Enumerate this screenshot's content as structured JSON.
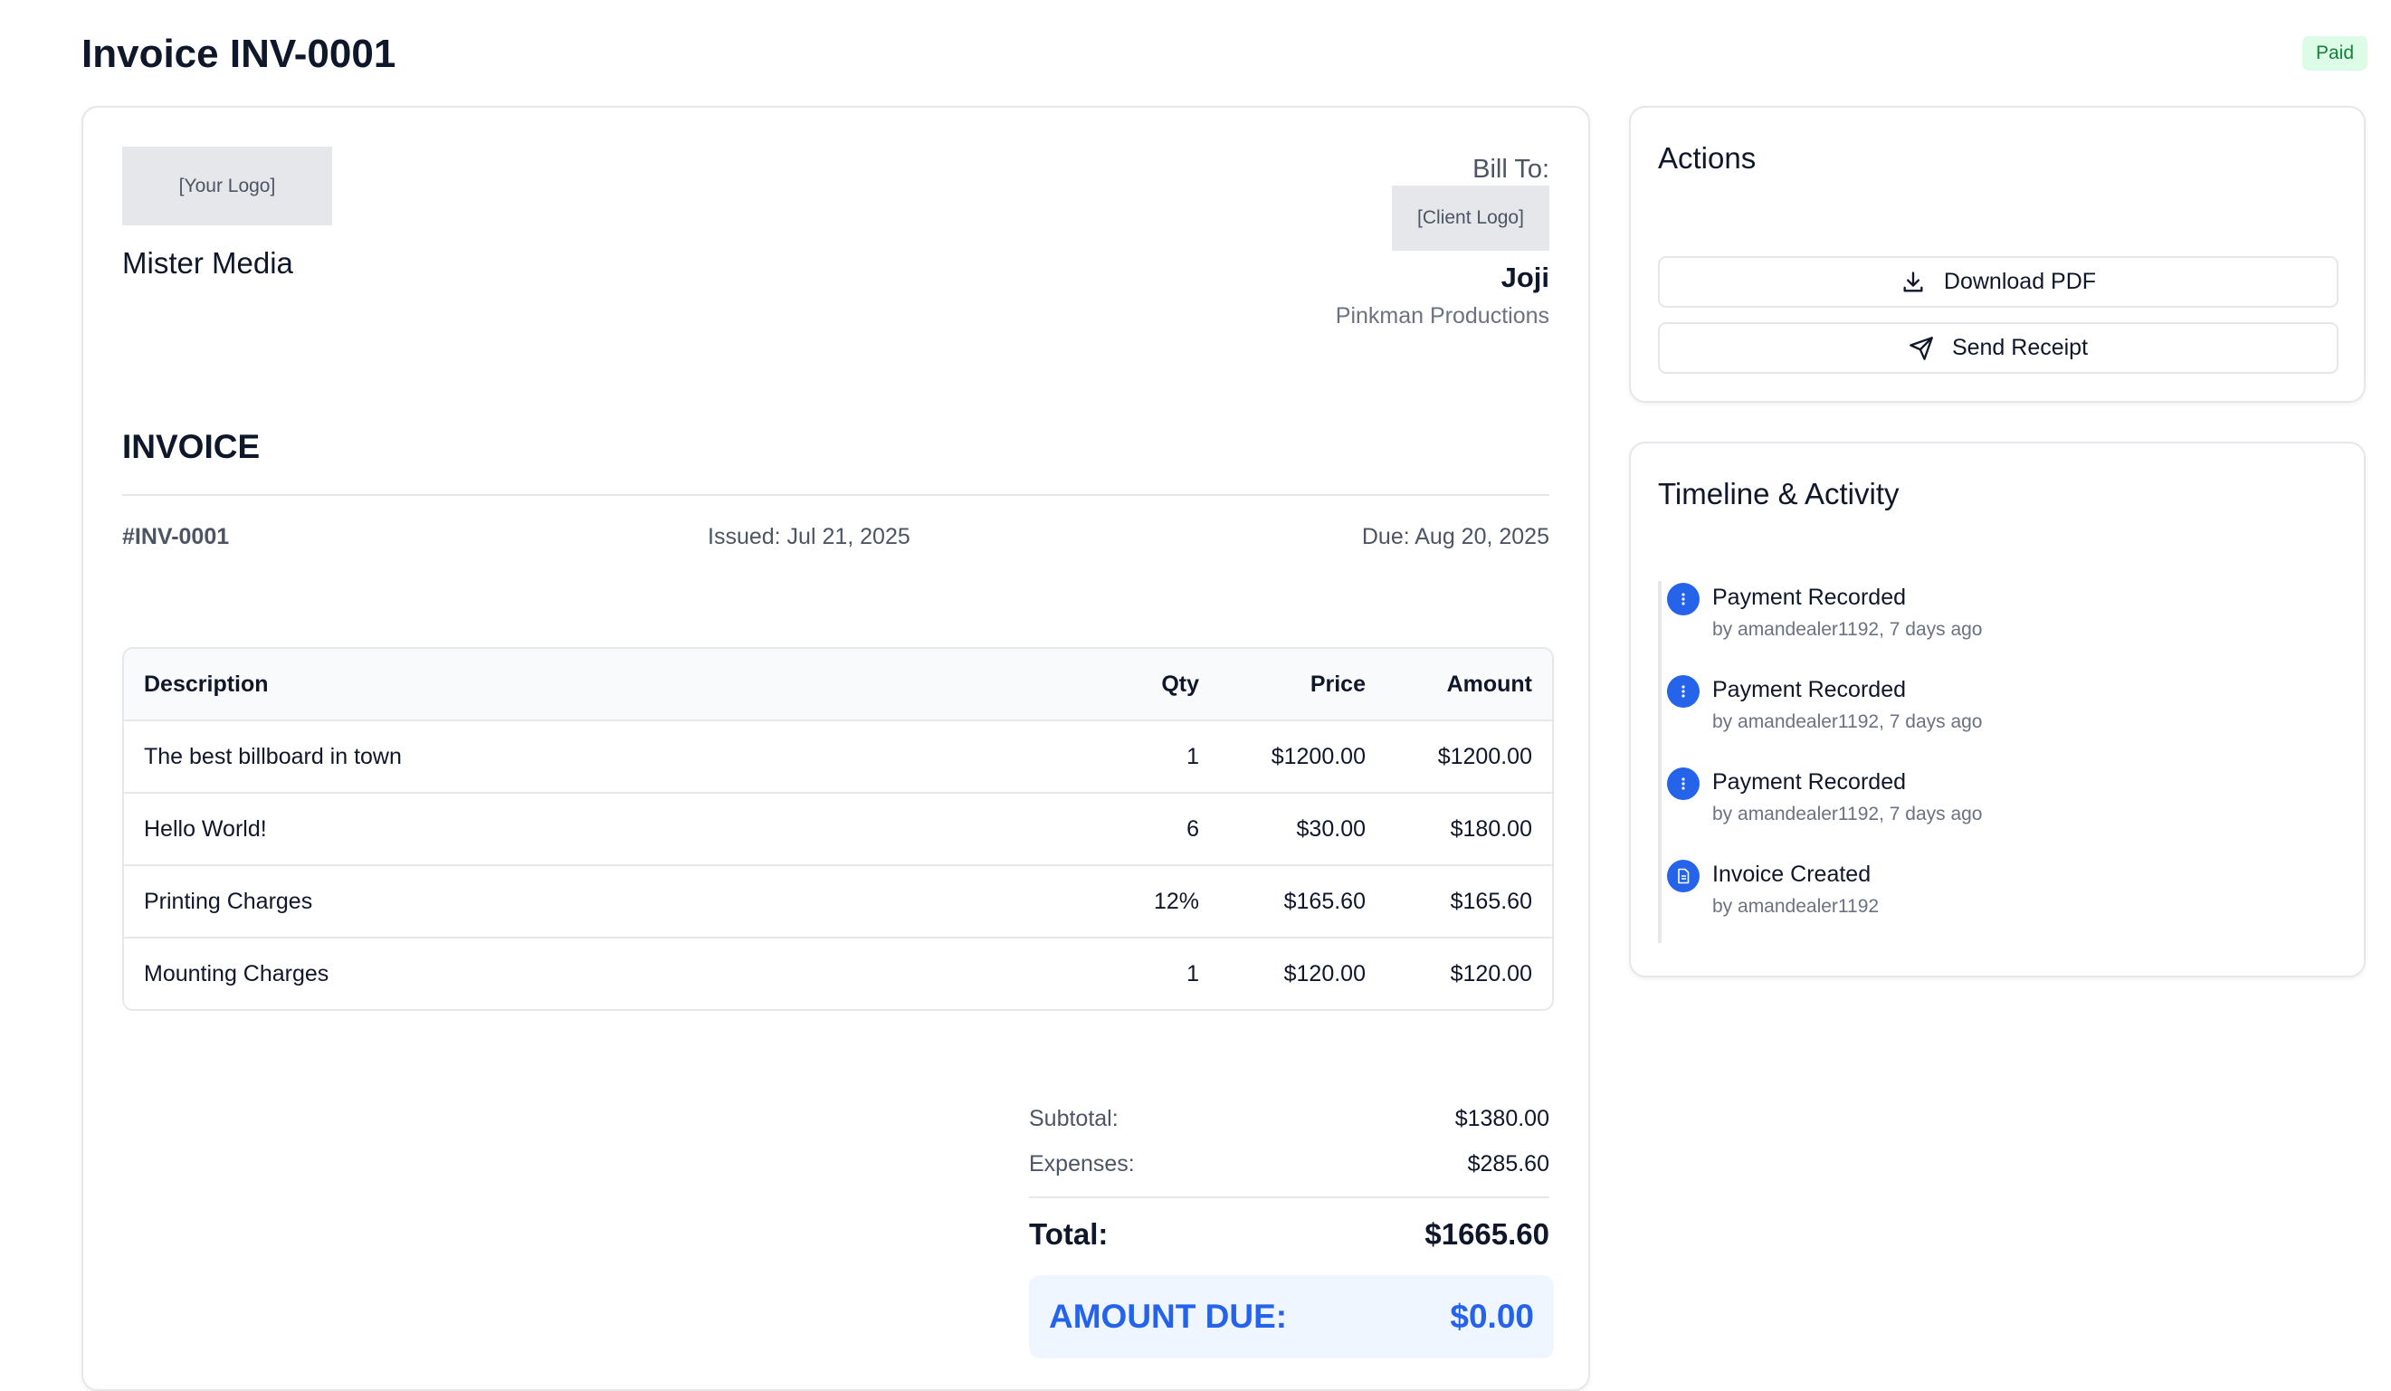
{
  "header": {
    "title": "Invoice INV-0001",
    "status": "Paid"
  },
  "invoice": {
    "your_logo": "[Your Logo]",
    "company_name": "Mister Media",
    "bill_to_label": "Bill To:",
    "client_logo": "[Client Logo]",
    "client_name": "Joji",
    "client_company": "Pinkman Productions",
    "heading": "INVOICE",
    "number": "#INV-0001",
    "issued": "Issued: Jul 21, 2025",
    "due": "Due: Aug 20, 2025",
    "table": {
      "headers": [
        "Description",
        "Qty",
        "Price",
        "Amount"
      ],
      "rows": [
        [
          "The best billboard in town",
          "1",
          "$1200.00",
          "$1200.00"
        ],
        [
          "Hello World!",
          "6",
          "$30.00",
          "$180.00"
        ],
        [
          "Printing Charges",
          "12%",
          "$165.60",
          "$165.60"
        ],
        [
          "Mounting Charges",
          "1",
          "$120.00",
          "$120.00"
        ]
      ]
    },
    "totals": {
      "subtotal_label": "Subtotal:",
      "subtotal": "$1380.00",
      "expenses_label": "Expenses:",
      "expenses": "$285.60",
      "total_label": "Total:",
      "total": "$1665.60",
      "amount_due_label": "AMOUNT DUE:",
      "amount_due": "$0.00"
    }
  },
  "actions": {
    "title": "Actions",
    "download_label": "Download PDF",
    "download_icon": "download-icon",
    "send_label": "Send Receipt",
    "send_icon": "send-icon"
  },
  "timeline": {
    "title": "Timeline & Activity",
    "items": [
      {
        "title": "Payment Recorded",
        "subtitle": "by amandealer1192, 7 days ago",
        "icon": "dots-vertical-icon"
      },
      {
        "title": "Payment Recorded",
        "subtitle": "by amandealer1192, 7 days ago",
        "icon": "dots-vertical-icon"
      },
      {
        "title": "Payment Recorded",
        "subtitle": "by amandealer1192, 7 days ago",
        "icon": "dots-vertical-icon"
      },
      {
        "title": "Invoice Created",
        "subtitle": "by amandealer1192",
        "icon": "document-icon"
      }
    ]
  },
  "colors": {
    "accent": "#2563eb",
    "paid_badge_bg": "#dcfce7",
    "paid_badge_text": "#15803d",
    "amount_due_bg": "#eff6ff"
  }
}
